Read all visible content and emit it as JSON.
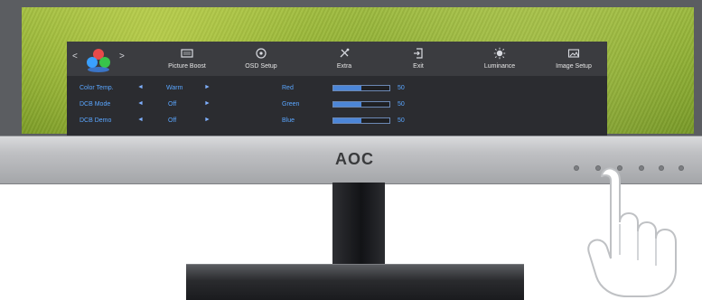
{
  "osd": {
    "nav": {
      "left_arrow": "<",
      "right_arrow": ">"
    },
    "top_menu": [
      {
        "label": "",
        "icon": "color-balls-icon"
      },
      {
        "label": "Picture Boost",
        "icon": "picture-boost-icon"
      },
      {
        "label": "OSD Setup",
        "icon": "osd-setup-icon"
      },
      {
        "label": "Extra",
        "icon": "extra-icon"
      },
      {
        "label": "Exit",
        "icon": "exit-icon"
      },
      {
        "label": "Luminance",
        "icon": "luminance-icon"
      },
      {
        "label": "Image Setup",
        "icon": "image-setup-icon"
      }
    ],
    "rows": [
      {
        "name": "Color Temp.",
        "value": "Warm"
      },
      {
        "name": "DCB Mode",
        "value": "Off"
      },
      {
        "name": "DCB Demo",
        "value": "Off"
      }
    ],
    "rgb": [
      {
        "name": "Red",
        "value": 50
      },
      {
        "name": "Green",
        "value": 50
      },
      {
        "name": "Blue",
        "value": 50
      }
    ],
    "colors": {
      "value_blue": "#5aa6ff",
      "bar_fill": "#4c86d8"
    }
  },
  "monitor": {
    "brand": "AOC",
    "buttons": [
      "power-button",
      "menu-button",
      "up-button",
      "down-button",
      "source-button",
      "auto-button"
    ]
  }
}
